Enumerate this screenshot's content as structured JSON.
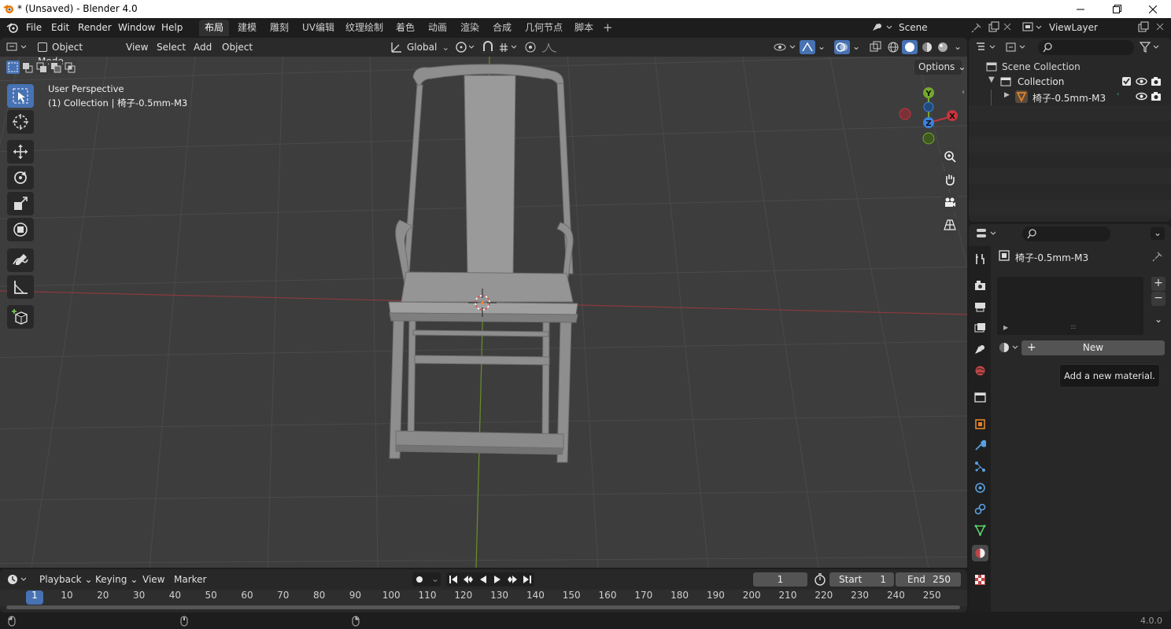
{
  "window": {
    "title": "* (Unsaved) - Blender 4.0"
  },
  "menu": [
    "File",
    "Edit",
    "Render",
    "Window",
    "Help"
  ],
  "workspaces": [
    "布局",
    "建模",
    "雕刻",
    "UV编辑",
    "纹理绘制",
    "着色",
    "动画",
    "渲染",
    "合成",
    "几何节点",
    "脚本"
  ],
  "scene": {
    "name": "Scene",
    "view_layer": "ViewLayer"
  },
  "viewport": {
    "mode": "Object Mode",
    "menus": [
      "View",
      "Select",
      "Add",
      "Object"
    ],
    "transform_orientation": "Global",
    "options_label": "Options",
    "overlay_line1": "User Perspective",
    "overlay_line2": "(1) Collection | 椅子-0.5mm-M3",
    "gizmo": {
      "y": "Y",
      "z": "Z",
      "x": "X"
    }
  },
  "outliner": {
    "scene_collection": "Scene Collection",
    "collection": "Collection",
    "object": "椅子-0.5mm-M3"
  },
  "properties": {
    "object_name": "椅子-0.5mm-M3",
    "new_button": "New",
    "tooltip": "Add a new material."
  },
  "timeline": {
    "menus": [
      "Playback",
      "Keying",
      "View",
      "Marker"
    ],
    "current_frame": "1",
    "start_label": "Start",
    "start_value": "1",
    "end_label": "End",
    "end_value": "250",
    "ruler": [
      "1",
      "10",
      "20",
      "30",
      "40",
      "50",
      "60",
      "70",
      "80",
      "90",
      "100",
      "110",
      "120",
      "130",
      "140",
      "150",
      "160",
      "170",
      "180",
      "190",
      "200",
      "210",
      "220",
      "230",
      "240",
      "250"
    ]
  },
  "status": {
    "version": "4.0.0"
  },
  "colors": {
    "accent": "#4772b3",
    "x_axis": "#c8343d",
    "y_axis": "#74a82c",
    "z_axis": "#3b82e0",
    "object_orange": "#e0842a"
  }
}
